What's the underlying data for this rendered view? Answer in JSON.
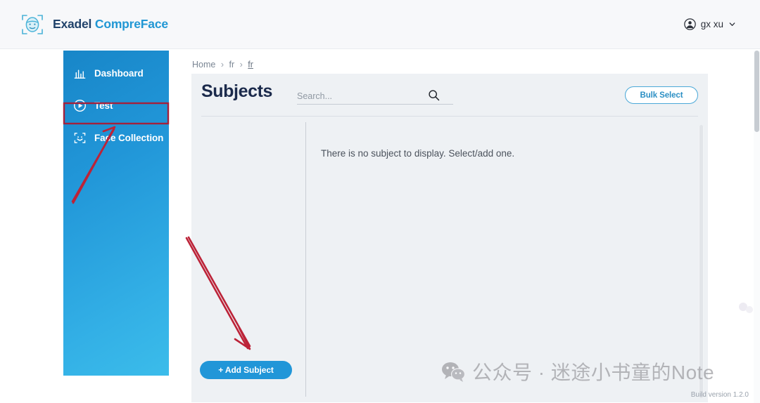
{
  "header": {
    "brand_word1": "Exadel ",
    "brand_word2": "CompreFace",
    "logo_icon": "face-scan-icon",
    "user_name": "gx xu",
    "user_icon": "account-circle-icon",
    "chevron_icon": "chevron-down-icon"
  },
  "sidebar": {
    "items": [
      {
        "label": "Dashboard",
        "icon": "bar-chart-icon"
      },
      {
        "label": "Test",
        "icon": "play-circle-icon"
      },
      {
        "label": "Face Collection",
        "icon": "face-scan-icon"
      }
    ]
  },
  "breadcrumb": {
    "home": "Home",
    "sep": "›",
    "level1": "fr",
    "level2": "fr"
  },
  "main": {
    "title": "Subjects",
    "search_placeholder": "Search...",
    "search_value": "",
    "search_icon": "search-icon",
    "bulk_select_label": "Bulk Select",
    "empty_message": "There is no subject to display. Select/add one.",
    "add_subject_label": "+ Add Subject"
  },
  "footer": {
    "build_version": "Build version 1.2.0"
  },
  "watermark": {
    "icon": "wechat-icon",
    "text": "公众号 · 迷途小书童的Note"
  },
  "colors": {
    "brand_dark": "#21436b",
    "brand_blue": "#2197d4",
    "sidebar_gradient_start": "#1886c8",
    "sidebar_gradient_end": "#3bbcea",
    "primary_button": "#2196d8",
    "annotation_red": "#c0243b",
    "card_background": "#eef1f4",
    "page_background": "#ffffff"
  },
  "annotations": {
    "highlight_box_target": "Face Collection",
    "arrow1_target": "Face Collection",
    "arrow2_target": "+ Add Subject"
  }
}
